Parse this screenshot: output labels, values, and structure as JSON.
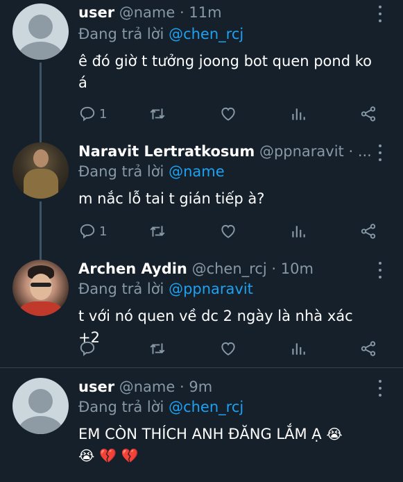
{
  "tweets": [
    {
      "name": "user",
      "handle": "@name",
      "time": "· 11m",
      "reply_prefix": "Đang trả lời",
      "reply_to": "@chen_rcj",
      "text": "ê đó giờ t tưởng joong bot quen pond ko á",
      "reply_count": "1",
      "avatar": "default-avatar"
    },
    {
      "name": "Naravit Lertratkosum",
      "handle": "@ppnaravit · ...",
      "time": "",
      "reply_prefix": "Đang trả lời",
      "reply_to": "@name",
      "text": "m nắc lỗ tai t gián tiếp à?",
      "reply_count": "1",
      "avatar": "profile-photo"
    },
    {
      "name": "Archen Aydin",
      "handle": "@chen_rcj",
      "time": "· 10m",
      "reply_prefix": "Đang trả lời",
      "reply_to": "@ppnaravit",
      "text": "t với nó quen về dc 2 ngày là nhà xác +2",
      "reply_count": "",
      "avatar": "profile-photo"
    },
    {
      "name": "user",
      "handle": "@name",
      "time": "· 9m",
      "reply_prefix": "Đang trả lời",
      "reply_to": "@chen_rcj",
      "text_line1": "EM CÒN THÍCH ANH ĐĂNG LẮM Ạ",
      "emojis": [
        "😭",
        "😭",
        "💔",
        "💔"
      ],
      "reply_count": "",
      "avatar": "default-avatar"
    }
  ],
  "icons": [
    "reply-icon",
    "retweet-icon",
    "like-icon",
    "analytics-icon",
    "share-icon",
    "more-icon"
  ],
  "colors": {
    "background": "#15202b",
    "link": "#1da1f2",
    "secondary_text": "#8899a6",
    "divider": "#38444d"
  }
}
